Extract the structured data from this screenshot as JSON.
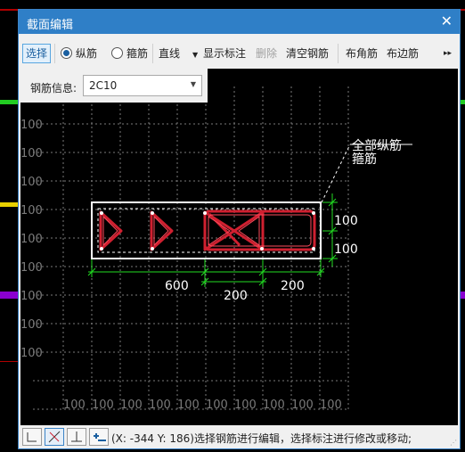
{
  "dialog": {
    "title": "截面编辑",
    "close_glyph": "✕"
  },
  "toolbar": {
    "select_label": "选择",
    "longitudinal_label": "纵筋",
    "stirrup_label": "箍筋",
    "linetype_label": "直线",
    "show_annotation_label": "显示标注",
    "delete_label": "删除",
    "clear_label": "清空钢筋",
    "corner_bar_label": "布角筋",
    "edge_bar_label": "布边筋",
    "more_glyph": "▸▸"
  },
  "info": {
    "label": "钢筋信息:",
    "value": "2C10"
  },
  "drawing": {
    "grid_label": "100",
    "leader_all_long": "全部纵筋",
    "leader_stirrup": "箍筋",
    "dim_top_right": "100",
    "dim_bottom_right": "100",
    "dim_600": "600",
    "dim_200_mid": "200",
    "dim_200_right": "200",
    "colors": {
      "rebar": "#d02030",
      "dim": "#22dd22",
      "grid": "#7a7a7a",
      "outline": "#ffffff"
    }
  },
  "statusbar": {
    "icons": [
      "ortho-icon",
      "snap-point-icon",
      "snap-perpendicular-icon",
      "add-dimension-icon"
    ],
    "text": "(X: -344 Y: 186)选择钢筋进行编辑，选择标注进行修改或移动;"
  }
}
